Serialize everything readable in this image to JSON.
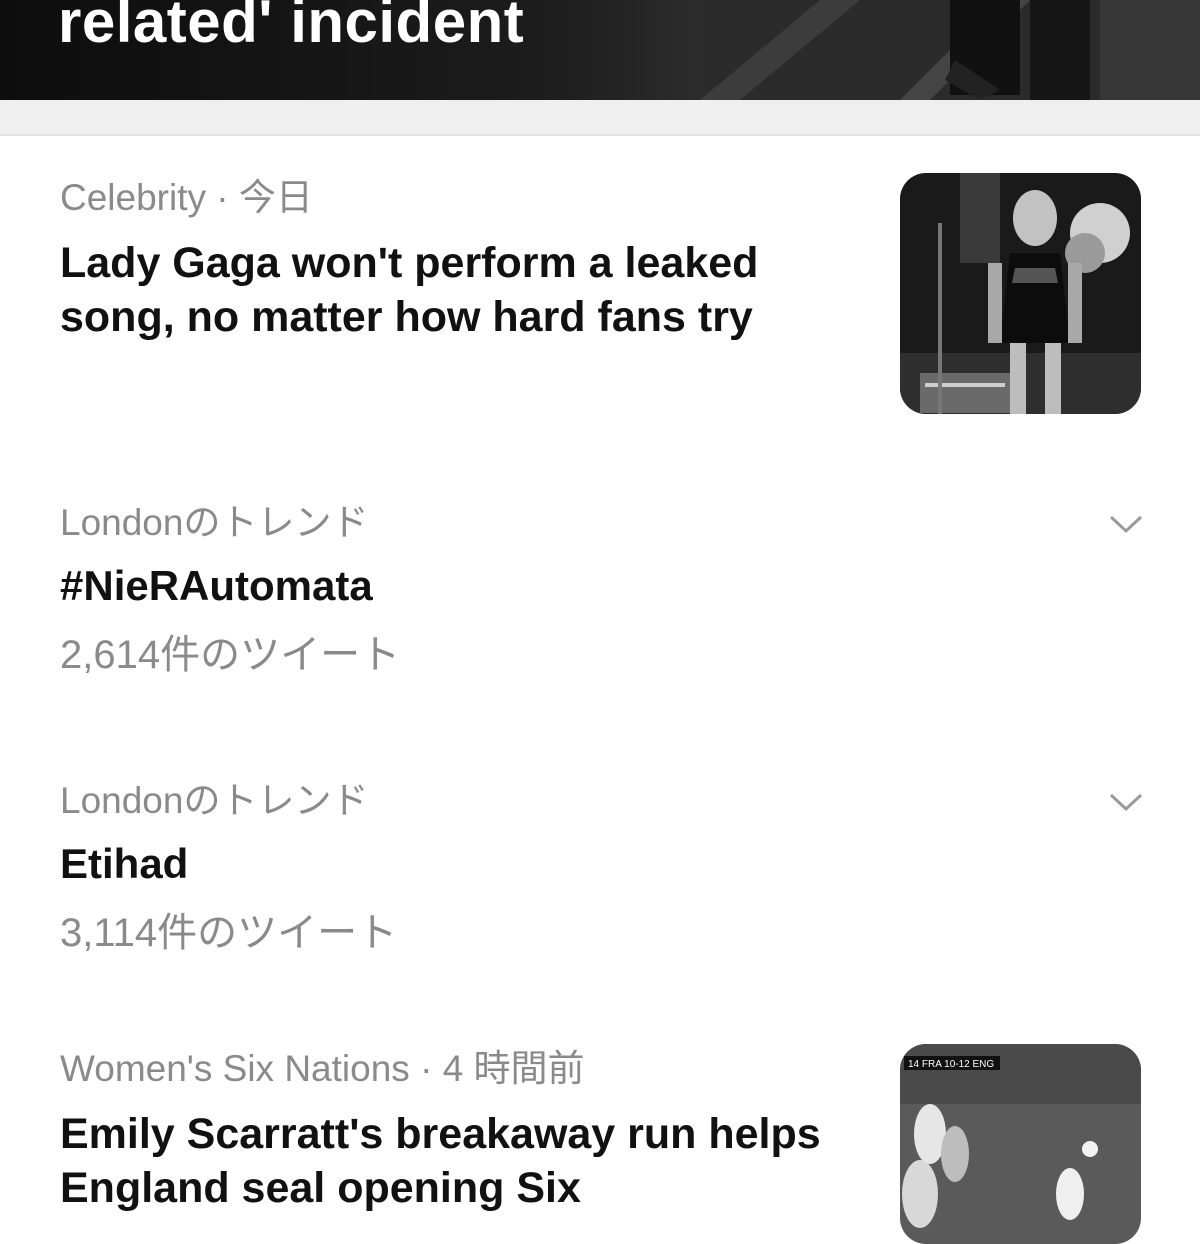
{
  "hero": {
    "title": "related' incident"
  },
  "stories": [
    {
      "category": "Celebrity",
      "separator": "·",
      "time": "今日",
      "headline": "Lady Gaga won't perform a leaked song, no matter how hard fans try",
      "thumbnail_icon": "concert-photo"
    },
    {
      "category": "Women's Six Nations",
      "separator": "·",
      "time": "4 時間前",
      "headline": "Emily Scarratt's breakaway run helps England seal opening Six",
      "headline_line2": "helps England seal opening Six",
      "scoreboard": "14 FRA 10-12 ENG",
      "thumbnail_icon": "rugby-photo"
    }
  ],
  "trends": [
    {
      "context": "Londonのトレンド",
      "title": "#NieRAutomata",
      "count": "2,614件のツイート",
      "menu_icon": "chevron-down-icon"
    },
    {
      "context": "Londonのトレンド",
      "title": "Etihad",
      "count": "3,114件のツイート",
      "menu_icon": "chevron-down-icon"
    }
  ],
  "colors": {
    "meta_gray": "#8a8a8a",
    "divider": "#dedede",
    "band": "#efefef"
  }
}
